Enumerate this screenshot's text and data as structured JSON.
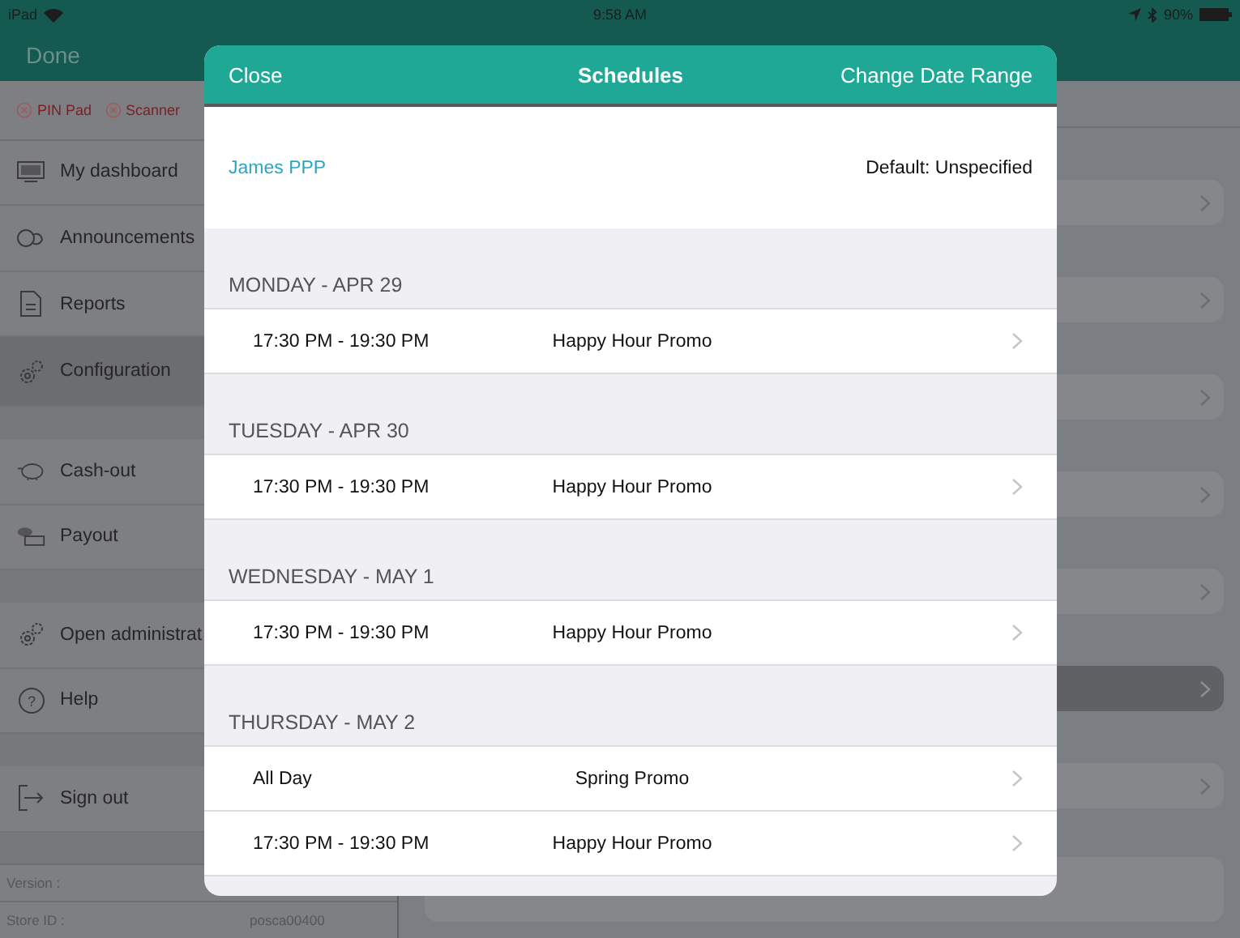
{
  "status_bar": {
    "device": "iPad",
    "time": "9:58 AM",
    "battery": "90%"
  },
  "nav_bar": {
    "done": "Done"
  },
  "sidebar": {
    "devices": [
      {
        "label": "PIN Pad"
      },
      {
        "label": "Scanner"
      }
    ],
    "groups": [
      [
        {
          "label": "My dashboard",
          "selected": false
        },
        {
          "label": "Announcements",
          "selected": false
        },
        {
          "label": "Reports",
          "selected": false
        },
        {
          "label": "Configuration",
          "selected": true
        }
      ],
      [
        {
          "label": "Cash-out",
          "selected": false
        },
        {
          "label": "Payout",
          "selected": false
        }
      ],
      [
        {
          "label": "Open administrat",
          "selected": false
        },
        {
          "label": "Help",
          "selected": false,
          "glyph": "?"
        }
      ],
      [
        {
          "label": "Sign out",
          "selected": false
        }
      ]
    ],
    "footer": {
      "version_label": "Version :",
      "store_label": "Store ID :",
      "store_id": "posca00400"
    }
  },
  "content_rows": [
    {
      "selected": false
    },
    {
      "selected": false
    },
    {
      "selected": false
    },
    {
      "selected": false
    },
    {
      "selected": false
    },
    {
      "selected": true
    },
    {
      "selected": false
    }
  ],
  "modal": {
    "close": "Close",
    "title": "Schedules",
    "action": "Change Date Range",
    "employee": "James PPP",
    "default": "Default: Unspecified",
    "days": [
      {
        "label": "MONDAY - APR 29",
        "entries": [
          {
            "time": "17:30 PM - 19:30 PM",
            "name": "Happy Hour Promo"
          }
        ]
      },
      {
        "label": "TUESDAY - APR 30",
        "entries": [
          {
            "time": "17:30 PM - 19:30 PM",
            "name": "Happy Hour Promo"
          }
        ]
      },
      {
        "label": "WEDNESDAY - MAY 1",
        "entries": [
          {
            "time": "17:30 PM - 19:30 PM",
            "name": "Happy Hour Promo"
          }
        ]
      },
      {
        "label": "THURSDAY - MAY 2",
        "entries": [
          {
            "time": "All Day",
            "name": "Spring Promo"
          },
          {
            "time": "17:30 PM - 19:30 PM",
            "name": "Happy Hour Promo"
          }
        ]
      }
    ]
  }
}
